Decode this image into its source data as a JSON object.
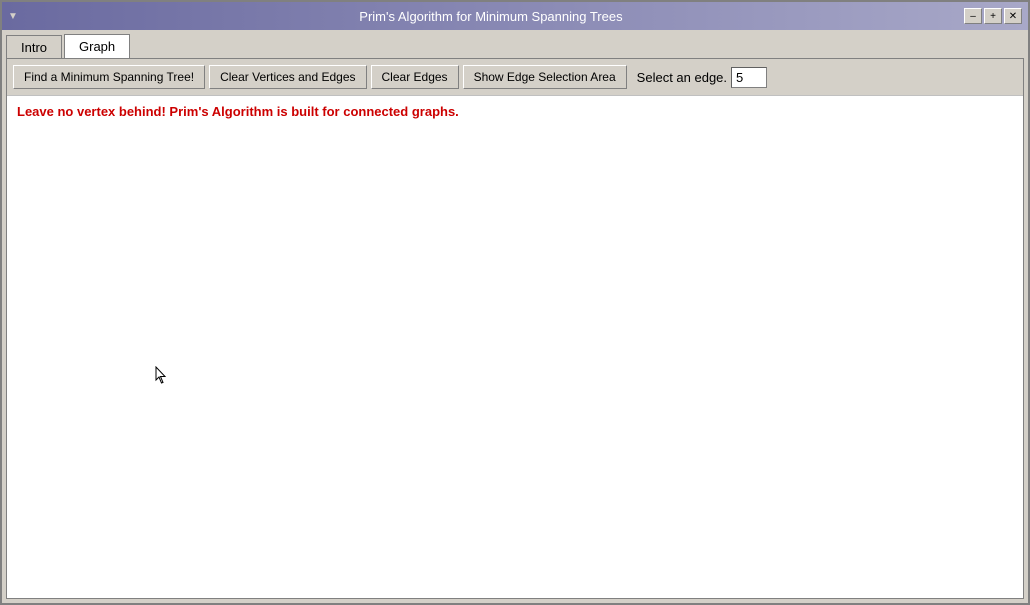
{
  "window": {
    "title": "Prim's Algorithm for Minimum Spanning Trees"
  },
  "titlebar": {
    "chevron": "▼",
    "minimize": "–",
    "maximize": "+",
    "close": "✕"
  },
  "tabs": [
    {
      "id": "intro",
      "label": "Intro",
      "active": false
    },
    {
      "id": "graph",
      "label": "Graph",
      "active": true
    }
  ],
  "toolbar": {
    "find_mst_label": "Find a Minimum Spanning Tree!",
    "clear_vertices_edges_label": "Clear Vertices and Edges",
    "clear_edges_label": "Clear Edges",
    "show_selection_area_label": "Show Edge Selection Area",
    "select_edge_label": "Select an edge.",
    "select_edge_value": "5"
  },
  "graph": {
    "warning_text": "Leave no vertex behind! Prim's Algorithm is built for connected graphs."
  }
}
